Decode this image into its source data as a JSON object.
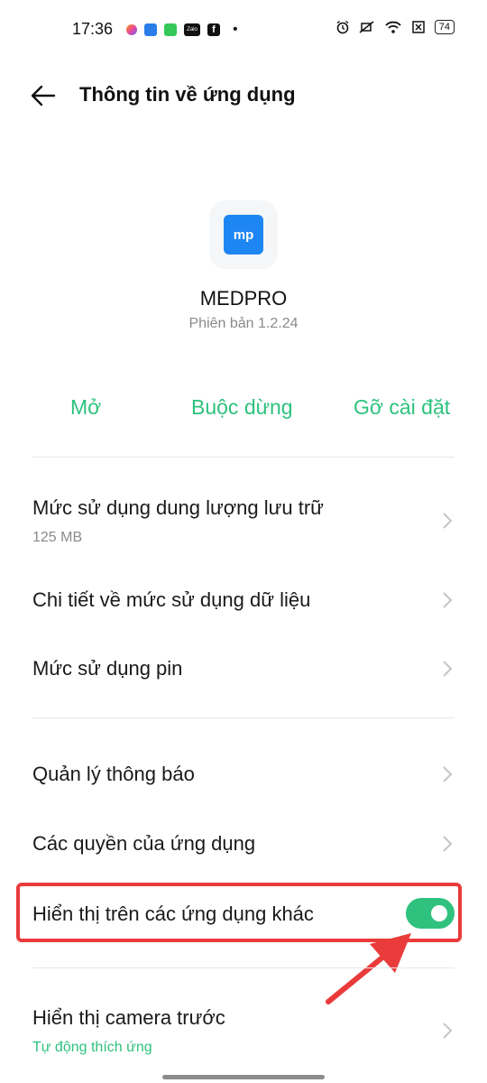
{
  "status_bar": {
    "time": "17:36",
    "battery": "74",
    "zalo": "Zalo",
    "facebook": "f",
    "dot": "•"
  },
  "header": {
    "title": "Thông tin về ứng dụng"
  },
  "app": {
    "icon_text": "mp",
    "name": "MEDPRO",
    "version": "Phiên bản 1.2.24"
  },
  "actions": {
    "open": "Mở",
    "force_stop": "Buộc dừng",
    "uninstall": "Gỡ cài đặt"
  },
  "rows": {
    "storage": {
      "label": "Mức sử dụng dung lượng lưu trữ",
      "value": "125 MB"
    },
    "data_usage": {
      "label": "Chi tiết về mức sử dụng dữ liệu"
    },
    "battery": {
      "label": "Mức sử dụng pin"
    },
    "notifications": {
      "label": "Quản lý thông báo"
    },
    "permissions": {
      "label": "Các quyền của ứng dụng"
    },
    "overlay": {
      "label": "Hiển thị trên các ứng dụng khác",
      "enabled": true
    },
    "front_camera": {
      "label": "Hiển thị camera trước",
      "value": "Tự động thích ứng"
    }
  },
  "colors": {
    "accent": "#2ec27e",
    "highlight": "#ea3b3b",
    "app_icon": "#1e86f2"
  }
}
